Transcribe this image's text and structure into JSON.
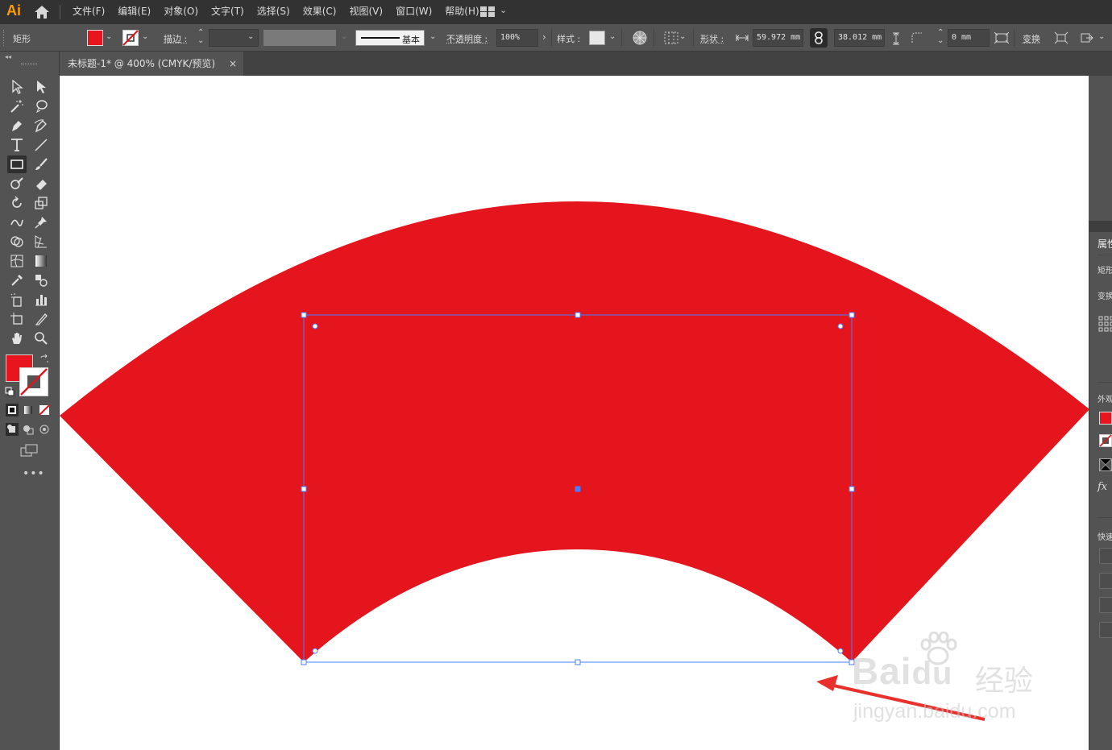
{
  "app": {
    "logo": "Ai",
    "menus": [
      "文件(F)",
      "编辑(E)",
      "对象(O)",
      "文字(T)",
      "选择(S)",
      "效果(C)",
      "视图(V)",
      "窗口(W)",
      "帮助(H)"
    ]
  },
  "control_bar": {
    "object_type": "矩形",
    "stroke_label": "描边 :",
    "stroke_profile": "基本",
    "opacity_label": "不透明度 :",
    "opacity_value": "100%",
    "style_label": "样式 :",
    "shape_label": "形状 :",
    "width_value": "59.972 mm",
    "height_value": "38.012 mm",
    "corner_value": "0 mm",
    "transform_label": "变换",
    "fill_color": "#e8141e"
  },
  "document_tab": {
    "title": "未标题-1* @ 400% (CMYK/预览)",
    "close": "×"
  },
  "canvas": {
    "shape_fill": "#e5151e",
    "selection_color": "#4a7cff",
    "annotation_arrow_color": "#e8302c"
  },
  "right_panel": {
    "title": "属性",
    "section_type": "矩形",
    "section_transform": "变换",
    "section_appearance": "外观",
    "fx_label": "fx",
    "section_quick": "快速"
  },
  "watermark": {
    "brand": "Bai",
    "brand_suffix": "du",
    "product": "经验",
    "url": "jingyan.baidu.com"
  }
}
